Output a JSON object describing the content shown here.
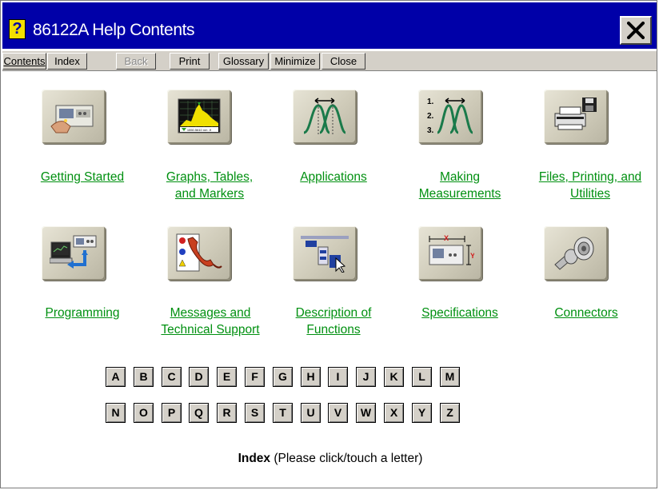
{
  "window": {
    "title": "86122A Help Contents",
    "app_icon_glyph": "?",
    "close_glyph": "close-x-icon"
  },
  "menubar": {
    "items": [
      {
        "label": "Contents",
        "enabled": true
      },
      {
        "label": "Index",
        "enabled": true
      },
      {
        "label": "Back",
        "enabled": false
      },
      {
        "label": "Print",
        "enabled": true
      },
      {
        "label": "Glossary",
        "enabled": true
      },
      {
        "label": "Minimize",
        "enabled": true
      },
      {
        "label": "Close",
        "enabled": true
      }
    ]
  },
  "topics": {
    "row1": [
      {
        "label_line1": "Getting Started",
        "label_line2": "",
        "icon": "instrument-hand-icon"
      },
      {
        "label_line1": "Graphs, Tables,",
        "label_line2": "and Markers",
        "icon": "graph-display-icon",
        "display_readout": "1550.5610 nm -9"
      },
      {
        "label_line1": "Applications",
        "label_line2": "",
        "icon": "wavelength-peaks-icon"
      },
      {
        "label_line1": "Making",
        "label_line2": "Measurements",
        "icon": "numbered-steps-icon",
        "steps": [
          "1.",
          "2.",
          "3."
        ]
      },
      {
        "label_line1": "Files, Printing, and",
        "label_line2": "Utilities",
        "icon": "printer-disk-icon"
      }
    ],
    "row2": [
      {
        "label_line1": "Programming",
        "label_line2": "",
        "icon": "computer-instrument-icon"
      },
      {
        "label_line1": "Messages and",
        "label_line2": "Technical Support",
        "icon": "phone-messages-icon"
      },
      {
        "label_line1": "Description of",
        "label_line2": "Functions",
        "icon": "function-blocks-icon"
      },
      {
        "label_line1": "Specifications",
        "label_line2": "",
        "icon": "dimensions-icon",
        "axis_x": "X",
        "axis_y": "Y"
      },
      {
        "label_line1": "Connectors",
        "label_line2": "",
        "icon": "fiber-connector-icon"
      }
    ]
  },
  "letters": {
    "row1": [
      "A",
      "B",
      "C",
      "D",
      "E",
      "F",
      "G",
      "H",
      "I",
      "J",
      "K",
      "L",
      "M"
    ],
    "row2": [
      "N",
      "O",
      "P",
      "Q",
      "R",
      "S",
      "T",
      "U",
      "V",
      "W",
      "X",
      "Y",
      "Z"
    ]
  },
  "index_note": {
    "bold": "Index",
    "rest": " (Please click/touch a letter)"
  },
  "colors": {
    "titlebar": "#0000a8",
    "link_green": "#009010",
    "button_face": "#d4d0c8",
    "tile_face": "#d6d2c0"
  }
}
